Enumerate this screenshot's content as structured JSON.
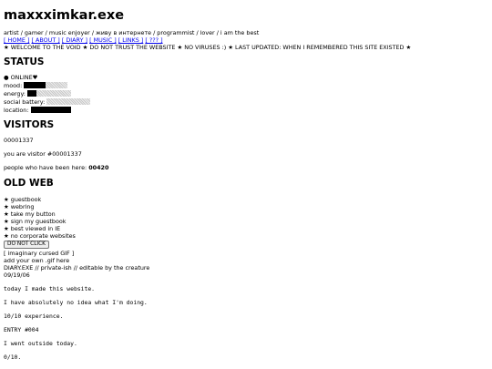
{
  "header": {
    "title": "maxxximkar.exe",
    "tagline": "artist / gamer / music enjoyer / живу в интернете / programmist / lover / i am the best"
  },
  "nav": [
    {
      "label": "[ HOME ]"
    },
    {
      "label": "[ ABOUT ]"
    },
    {
      "label": "[ DIARY ]"
    },
    {
      "label": "[ MUSIC ]"
    },
    {
      "label": "[ LINKS ]"
    },
    {
      "label": "[ ??? ]"
    }
  ],
  "marquee": "★ WELCOME TO THE VOID ★ DO NOT TRUST THE WEBSITE ★ NO VIRUSES :) ★ LAST UPDATED: WHEN I REMEMBERED THIS SITE EXISTED ★",
  "status": {
    "heading": "STATUS",
    "online": "● ONLINE♥",
    "bars": [
      {
        "label": "mood:",
        "fill": 0.5
      },
      {
        "label": "energy:",
        "fill": 0.2
      },
      {
        "label": "social battery:",
        "fill": 0.0
      },
      {
        "label": "location:",
        "fill": 1.0
      }
    ]
  },
  "visitors": {
    "heading": "VISITORS",
    "counter": "00001337",
    "you_are": "you are visitor #00001337",
    "been_here_prefix": "people who have been here: ",
    "been_here_count": "00420"
  },
  "oldweb": {
    "heading": "OLD WEB",
    "items": [
      "★ guestbook",
      "★ webring",
      "★ take my button",
      "★ sign my guestbook",
      "★ best viewed in IE",
      "★ no corporate websites"
    ],
    "button_label": "DO NOT CLICK",
    "gif_text": "[ imaginary cursed GIF ]",
    "gif_note": "add your own .gif here"
  },
  "diary": {
    "title": "DIARY.EXE // private-ish // editable by the creature",
    "date": "09/19/06",
    "entries": [
      "today I made this website.",
      "I have absolutely no idea what I'm doing.",
      "10/10 experience.",
      "ENTRY #004",
      "I went outside today.",
      "0/10."
    ]
  }
}
